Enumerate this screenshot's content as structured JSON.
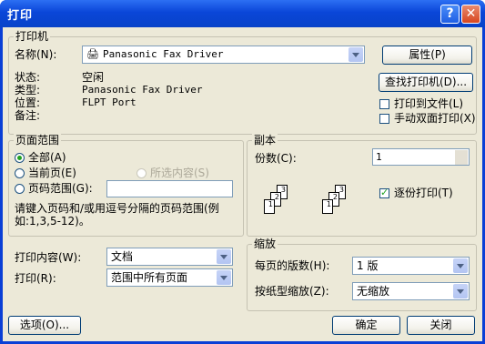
{
  "window": {
    "title": "打印",
    "help_glyph": "?",
    "close_glyph": "✕"
  },
  "printer": {
    "group_label": "打印机",
    "name_label": "名称(N):",
    "name_value": "Panasonic Fax Driver",
    "properties_button": "属性(P)",
    "status_label": "状态:",
    "status_value": "空闲",
    "type_label": "类型:",
    "type_value": "Panasonic Fax Driver",
    "where_label": "位置:",
    "where_value": "FLPT Port",
    "comment_label": "备注:",
    "find_button": "查找打印机(D)...",
    "print_to_file": "打印到文件(L)",
    "manual_duplex": "手动双面打印(X)"
  },
  "page_range": {
    "group_label": "页面范围",
    "all": "全部(A)",
    "current": "当前页(E)",
    "selection": "所选内容(S)",
    "pages": "页码范围(G):",
    "pages_value": "",
    "hint_line1": "请键入页码和/或用逗号分隔的页码范围(例",
    "hint_line2": "如:1,3,5-12)。"
  },
  "copies": {
    "group_label": "副本",
    "count_label": "份数(C):",
    "count_value": "1",
    "collate": "逐份打印(T)",
    "collate_checked": true,
    "page_labels": [
      "1",
      "2",
      "3",
      "1",
      "2",
      "3"
    ]
  },
  "print_what": {
    "label": "打印内容(W):",
    "value": "文档"
  },
  "print": {
    "label": "打印(R):",
    "value": "范围中所有页面"
  },
  "zoom": {
    "group_label": "缩放",
    "pages_per_sheet_label": "每页的版数(H):",
    "pages_per_sheet_value": "1 版",
    "scale_label": "按纸型缩放(Z):",
    "scale_value": "无缩放"
  },
  "footer": {
    "options": "选项(O)...",
    "ok": "确定",
    "close": "关闭"
  },
  "colors": {
    "titlebar": "#0a46d8",
    "dialog": "#ece9d8",
    "check_green": "#21a121"
  }
}
